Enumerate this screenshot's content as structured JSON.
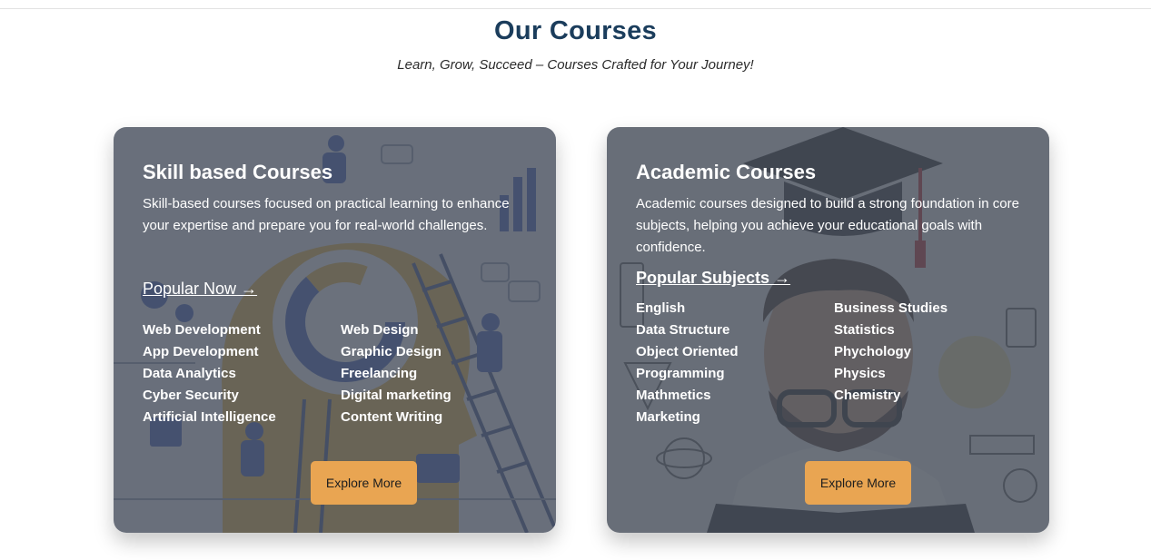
{
  "header": {
    "title": "Our Courses",
    "subtitle": "Learn, Grow, Succeed – Courses Crafted for Your Journey!"
  },
  "cards": [
    {
      "title": "Skill based Courses",
      "description": "Skill-based courses focused on practical learning to enhance your expertise and prepare you for real-world challenges.",
      "link_label": "Popular Now →",
      "column_1": [
        "Web Development",
        "App Development",
        "Data Analytics",
        "Cyber Security",
        "Artificial Intelligence"
      ],
      "column_2": [
        "Web Design",
        "Graphic Design",
        "Freelancing",
        "Digital marketing",
        "Content Writing"
      ],
      "button_label": "Explore More"
    },
    {
      "title": "Academic Courses",
      "description": "Academic courses designed to build a strong foundation in core subjects, helping you achieve your educational goals with confidence.",
      "link_label": "Popular Subjects →",
      "column_1": [
        "English",
        "Data Structure",
        "Object Oriented",
        "Programming",
        "Mathmetics",
        "Marketing"
      ],
      "column_2": [
        "Business Studies",
        "Statistics",
        "Phychology",
        "Physics",
        "Chemistry"
      ],
      "button_label": "Explore More"
    }
  ],
  "colors": {
    "heading": "#1b3d5c",
    "card_overlay": "#49505c",
    "button": "#e9a552"
  }
}
